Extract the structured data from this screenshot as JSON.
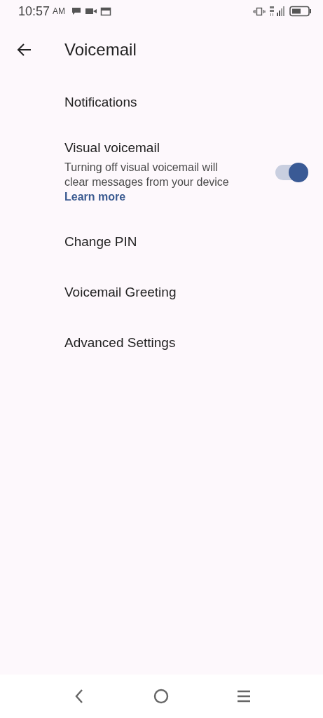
{
  "status_bar": {
    "time": "10:57",
    "period": "AM"
  },
  "header": {
    "title": "Voicemail"
  },
  "items": [
    {
      "kind": "plain",
      "label": "Notifications"
    },
    {
      "kind": "toggle",
      "label": "Visual voicemail",
      "description": "Turning off visual voicemail will clear messages from your device",
      "link": "Learn more",
      "on": true
    },
    {
      "kind": "plain",
      "label": "Change PIN"
    },
    {
      "kind": "plain",
      "label": "Voicemail Greeting"
    },
    {
      "kind": "plain",
      "label": "Advanced Settings"
    }
  ]
}
